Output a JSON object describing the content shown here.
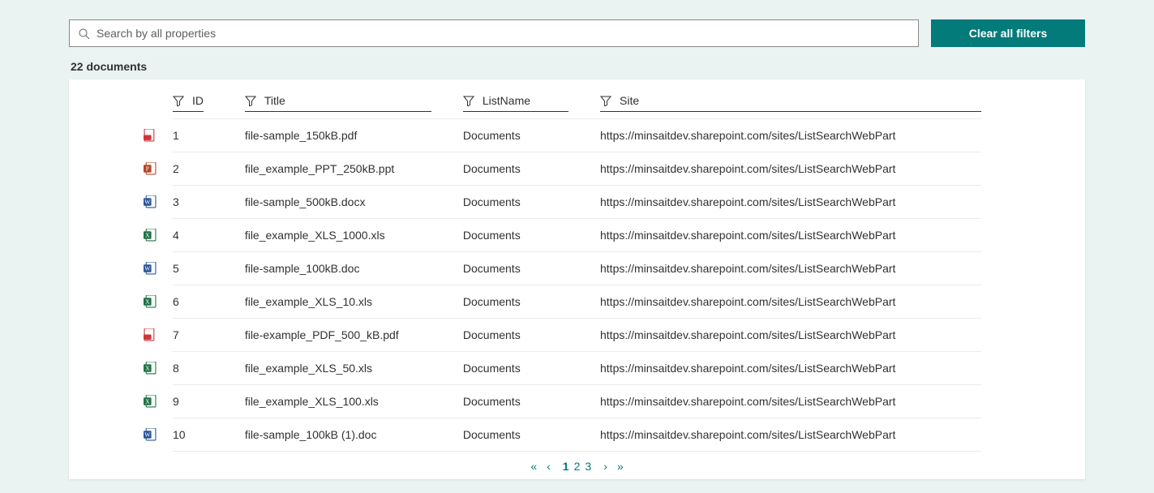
{
  "search": {
    "placeholder": "Search by all properties",
    "value": ""
  },
  "clear_filters_label": "Clear all filters",
  "count_label": "22 documents",
  "columns": {
    "id": "ID",
    "title": "Title",
    "listname": "ListName",
    "site": "Site"
  },
  "rows": [
    {
      "icon": "pdf",
      "id": "1",
      "title": "file-sample_150kB.pdf",
      "list": "Documents",
      "site": "https://minsaitdev.sharepoint.com/sites/ListSearchWebPart"
    },
    {
      "icon": "ppt",
      "id": "2",
      "title": "file_example_PPT_250kB.ppt",
      "list": "Documents",
      "site": "https://minsaitdev.sharepoint.com/sites/ListSearchWebPart"
    },
    {
      "icon": "docx",
      "id": "3",
      "title": "file-sample_500kB.docx",
      "list": "Documents",
      "site": "https://minsaitdev.sharepoint.com/sites/ListSearchWebPart"
    },
    {
      "icon": "xls",
      "id": "4",
      "title": "file_example_XLS_1000.xls",
      "list": "Documents",
      "site": "https://minsaitdev.sharepoint.com/sites/ListSearchWebPart"
    },
    {
      "icon": "doc",
      "id": "5",
      "title": "file-sample_100kB.doc",
      "list": "Documents",
      "site": "https://minsaitdev.sharepoint.com/sites/ListSearchWebPart"
    },
    {
      "icon": "xls",
      "id": "6",
      "title": "file_example_XLS_10.xls",
      "list": "Documents",
      "site": "https://minsaitdev.sharepoint.com/sites/ListSearchWebPart"
    },
    {
      "icon": "pdf",
      "id": "7",
      "title": "file-example_PDF_500_kB.pdf",
      "list": "Documents",
      "site": "https://minsaitdev.sharepoint.com/sites/ListSearchWebPart"
    },
    {
      "icon": "xls",
      "id": "8",
      "title": "file_example_XLS_50.xls",
      "list": "Documents",
      "site": "https://minsaitdev.sharepoint.com/sites/ListSearchWebPart"
    },
    {
      "icon": "xls",
      "id": "9",
      "title": "file_example_XLS_100.xls",
      "list": "Documents",
      "site": "https://minsaitdev.sharepoint.com/sites/ListSearchWebPart"
    },
    {
      "icon": "doc",
      "id": "10",
      "title": "file-sample_100kB (1).doc",
      "list": "Documents",
      "site": "https://minsaitdev.sharepoint.com/sites/ListSearchWebPart"
    }
  ],
  "pager": {
    "pages": [
      "1",
      "2",
      "3"
    ],
    "current": "1"
  }
}
